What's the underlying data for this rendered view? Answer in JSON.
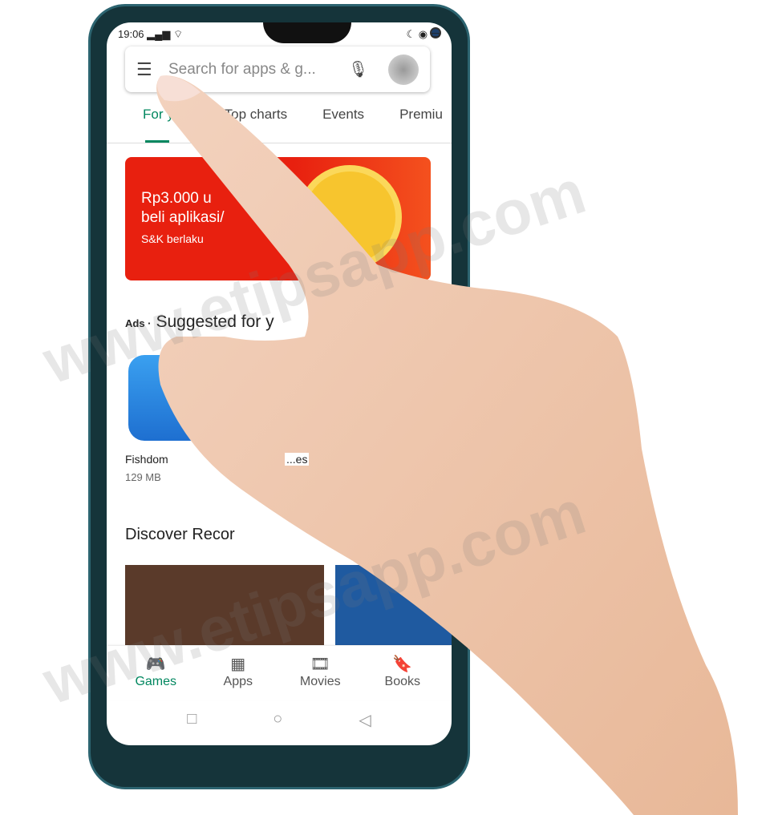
{
  "status": {
    "time": "19:06"
  },
  "search": {
    "placeholder": "Search for apps & g..."
  },
  "tabs": [
    {
      "label": "For you"
    },
    {
      "label": "Top charts"
    },
    {
      "label": "Events"
    },
    {
      "label": "Premiu"
    }
  ],
  "banner": {
    "line1": "Rp3.000 u",
    "line2": "beli aplikasi/",
    "terms": "S&K berlaku"
  },
  "suggested": {
    "ads": "Ads ·",
    "title": "Suggested for y",
    "apps": [
      {
        "name": "Fishdom",
        "size": "129 MB"
      },
      {
        "name": "...es",
        "size": ""
      }
    ]
  },
  "discover": {
    "title": "Discover Recor"
  },
  "bottom_nav": [
    {
      "label": "Games",
      "icon": "gamepad-icon"
    },
    {
      "label": "Apps",
      "icon": "grid-icon"
    },
    {
      "label": "Movies",
      "icon": "film-icon"
    },
    {
      "label": "Books",
      "icon": "bookmark-icon"
    }
  ],
  "watermark": "www.etipsapp.com",
  "colors": {
    "accent": "#01875f",
    "banner": "#e8200f",
    "frame": "#15343a",
    "skin": "#f0c8ae"
  }
}
